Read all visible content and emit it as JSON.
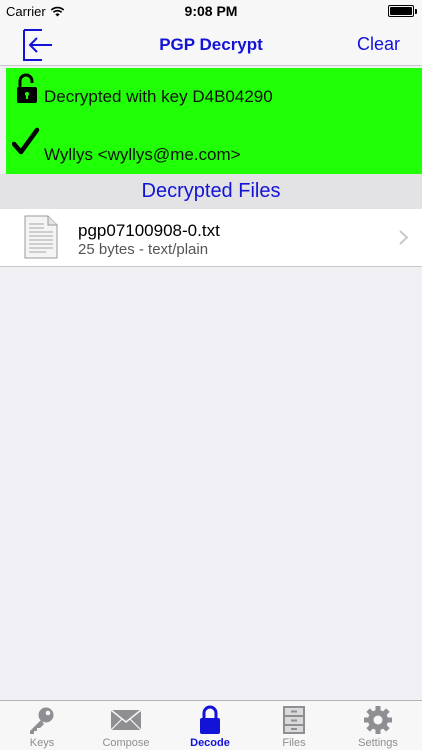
{
  "status_bar": {
    "carrier": "Carrier",
    "time": "9:08 PM",
    "wifi_icon": "wifi-icon",
    "battery_icon": "battery-icon"
  },
  "nav": {
    "back_icon": "exit-arrow-icon",
    "title": "PGP Decrypt",
    "clear_label": "Clear",
    "accent_color": "#1313D8"
  },
  "status_panel": {
    "background_color": "#21FF06",
    "key_text": "Decrypted with key D4B04290",
    "key_icon": "unlocked-padlock-icon",
    "signer_text": "Wyllys <wyllys@me.com>",
    "signer_icon": "checkmark-icon"
  },
  "section": {
    "title": "Decrypted Files"
  },
  "files": [
    {
      "name": "pgp07100908-0.txt",
      "meta": "25 bytes - text/plain",
      "icon": "document-icon"
    }
  ],
  "tabs": [
    {
      "label": "Keys",
      "icon": "key-icon",
      "active": false
    },
    {
      "label": "Compose",
      "icon": "envelope-icon",
      "active": false
    },
    {
      "label": "Decode",
      "icon": "padlock-icon",
      "active": true
    },
    {
      "label": "Files",
      "icon": "file-cabinet-icon",
      "active": false
    },
    {
      "label": "Settings",
      "icon": "gear-icon",
      "active": false
    }
  ]
}
